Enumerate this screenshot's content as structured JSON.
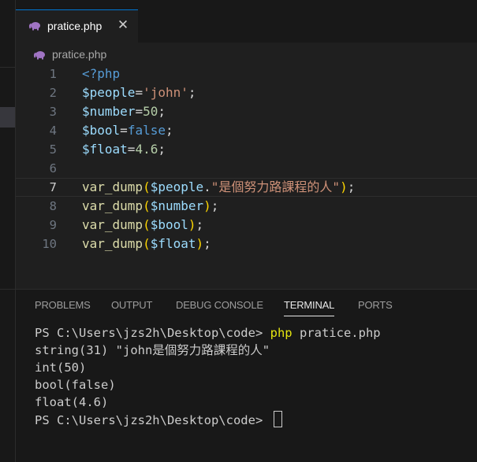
{
  "tab": {
    "label": "pratice.php",
    "close": "✕",
    "icon": "php-elephant-icon"
  },
  "breadcrumb": {
    "label": "pratice.php"
  },
  "editor": {
    "lines": [
      {
        "n": "1",
        "tokens": [
          [
            "kw",
            "<?php"
          ]
        ]
      },
      {
        "n": "2",
        "tokens": [
          [
            "var",
            "$people"
          ],
          [
            "op",
            "="
          ],
          [
            "str",
            "'john'"
          ],
          [
            "op",
            ";"
          ]
        ]
      },
      {
        "n": "3",
        "tokens": [
          [
            "var",
            "$number"
          ],
          [
            "op",
            "="
          ],
          [
            "num",
            "50"
          ],
          [
            "op",
            ";"
          ]
        ]
      },
      {
        "n": "4",
        "tokens": [
          [
            "var",
            "$bool"
          ],
          [
            "op",
            "="
          ],
          [
            "kw",
            "false"
          ],
          [
            "op",
            ";"
          ]
        ]
      },
      {
        "n": "5",
        "tokens": [
          [
            "var",
            "$float"
          ],
          [
            "op",
            "="
          ],
          [
            "num",
            "4.6"
          ],
          [
            "op",
            ";"
          ]
        ]
      },
      {
        "n": "6",
        "tokens": []
      },
      {
        "n": "7",
        "current": true,
        "tokens": [
          [
            "fn",
            "var_dump"
          ],
          [
            "br",
            "("
          ],
          [
            "var",
            "$people"
          ],
          [
            "op",
            "."
          ],
          [
            "str",
            "\"是個努力路課程的人\""
          ],
          [
            "br",
            ")"
          ],
          [
            "op",
            ";"
          ]
        ]
      },
      {
        "n": "8",
        "tokens": [
          [
            "fn",
            "var_dump"
          ],
          [
            "br",
            "("
          ],
          [
            "var",
            "$number"
          ],
          [
            "br",
            ")"
          ],
          [
            "op",
            ";"
          ]
        ]
      },
      {
        "n": "9",
        "tokens": [
          [
            "fn",
            "var_dump"
          ],
          [
            "br",
            "("
          ],
          [
            "var",
            "$bool"
          ],
          [
            "br",
            ")"
          ],
          [
            "op",
            ";"
          ]
        ]
      },
      {
        "n": "10",
        "tokens": [
          [
            "fn",
            "var_dump"
          ],
          [
            "br",
            "("
          ],
          [
            "var",
            "$float"
          ],
          [
            "br",
            ")"
          ],
          [
            "op",
            ";"
          ]
        ]
      }
    ]
  },
  "panel": {
    "tabs": [
      "PROBLEMS",
      "OUTPUT",
      "DEBUG CONSOLE",
      "TERMINAL",
      "PORTS"
    ],
    "active_tab": "TERMINAL"
  },
  "terminal": {
    "prompt": "PS C:\\Users\\jzs2h\\Desktop\\code> ",
    "command": "php",
    "command_args": " pratice.php",
    "output": [
      "string(31) \"john是個努力路課程的人\"",
      "int(50)",
      "bool(false)",
      "float(4.6)"
    ],
    "prompt2": "PS C:\\Users\\jzs2h\\Desktop\\code> "
  },
  "colors": {
    "accent": "#0078d4",
    "php_icon": "#a074c4"
  }
}
